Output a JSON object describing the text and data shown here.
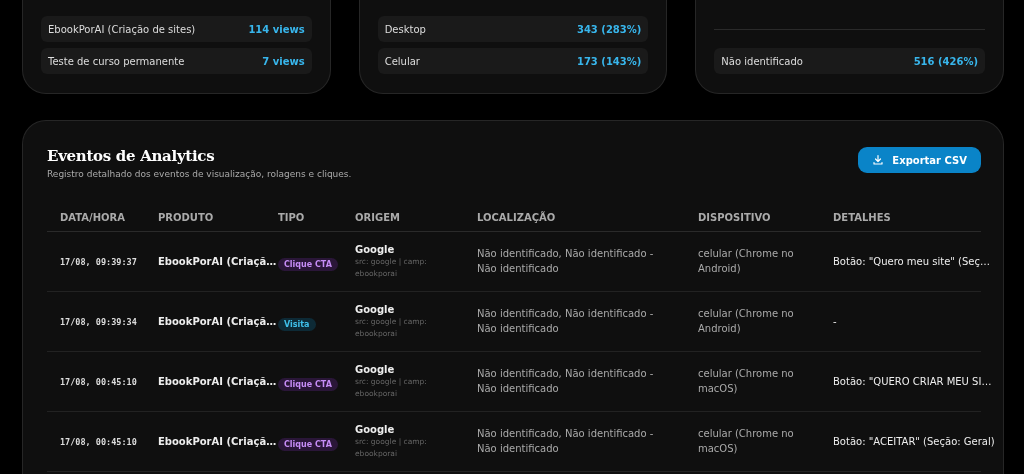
{
  "summary_cards": [
    {
      "rows": [
        {
          "label": "EbookPorAI (Criação de sites)",
          "value": "114 views"
        },
        {
          "label": "Teste de curso permanente",
          "value": "7 views"
        }
      ]
    },
    {
      "rows": [
        {
          "label": "Desktop",
          "value": "343 (283%)"
        },
        {
          "label": "Celular",
          "value": "173 (143%)"
        }
      ]
    },
    {
      "rows": [
        {
          "label": "Não identificado",
          "value": "516 (426%)"
        }
      ]
    }
  ],
  "events": {
    "title": "Eventos de Analytics",
    "subtitle": "Registro detalhado dos eventos de visualização, rolagens e cliques.",
    "export_button": "Exportar CSV",
    "columns": [
      "DATA/HORA",
      "PRODUTO",
      "TIPO",
      "ORIGEM",
      "LOCALIZAÇÃO",
      "DISPOSITIVO",
      "DETALHES"
    ],
    "rows": [
      {
        "datetime": "17/08, 09:39:37",
        "product": "EbookPorAI (Criaçã…",
        "type": {
          "kind": "cta",
          "label": "Clique CTA"
        },
        "origin": "Google",
        "origin_detail": "src: google | camp: ebookporai",
        "location": "Não identificado, Não identificado - Não identificado",
        "device": "celular (Chrome no Android)",
        "details": "Botão: \"Quero meu site\" (Seç…"
      },
      {
        "datetime": "17/08, 09:39:34",
        "product": "EbookPorAI (Criaçã…",
        "type": {
          "kind": "visit",
          "label": "Visita"
        },
        "origin": "Google",
        "origin_detail": "src: google | camp: ebookporai",
        "location": "Não identificado, Não identificado - Não identificado",
        "device": "celular (Chrome no Android)",
        "details": "-"
      },
      {
        "datetime": "17/08, 00:45:10",
        "product": "EbookPorAI (Criaçã…",
        "type": {
          "kind": "cta",
          "label": "Clique CTA"
        },
        "origin": "Google",
        "origin_detail": "src: google | camp: ebookporai",
        "location": "Não identificado, Não identificado - Não identificado",
        "device": "celular (Chrome no macOS)",
        "details": "Botão: \"QUERO CRIAR MEU SI…"
      },
      {
        "datetime": "17/08, 00:45:10",
        "product": "EbookPorAI (Criaçã…",
        "type": {
          "kind": "cta",
          "label": "Clique CTA"
        },
        "origin": "Google",
        "origin_detail": "src: google | camp: ebookporai",
        "location": "Não identificado, Não identificado - Não identificado",
        "device": "celular (Chrome no macOS)",
        "details": "Botão: \"ACEITAR\" (Seção: Geral)"
      }
    ]
  }
}
